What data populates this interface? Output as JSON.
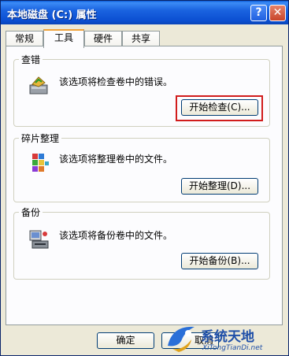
{
  "window": {
    "title": "本地磁盘 (C:) 属性",
    "help_glyph": "?",
    "close_glyph": "✕"
  },
  "tabs": [
    "常规",
    "工具",
    "硬件",
    "共享"
  ],
  "active_tab": "工具",
  "sections": {
    "check": {
      "label": "查错",
      "description": "该选项将检查卷中的错误。",
      "button": "开始检查(C)..."
    },
    "defrag": {
      "label": "碎片整理",
      "description": "该选项将整理卷中的文件。",
      "button": "开始整理(D)..."
    },
    "backup": {
      "label": "备份",
      "description": "该选项将备份卷中的文件。",
      "button": "开始备份(B)..."
    }
  },
  "footer": {
    "ok": "确定",
    "cancel_partial": "取消"
  },
  "watermark": {
    "text": "系统天地",
    "url": "XiTongTianDi.net"
  },
  "colors": {
    "titlebar": "#0b4ed1",
    "highlight": "#d11c1c",
    "panel": "#fcfcfe",
    "window": "#ece9d8"
  },
  "icons": [
    "help-icon",
    "close-icon",
    "check-disk-icon",
    "defrag-icon",
    "backup-icon",
    "watermark-logo-icon"
  ]
}
